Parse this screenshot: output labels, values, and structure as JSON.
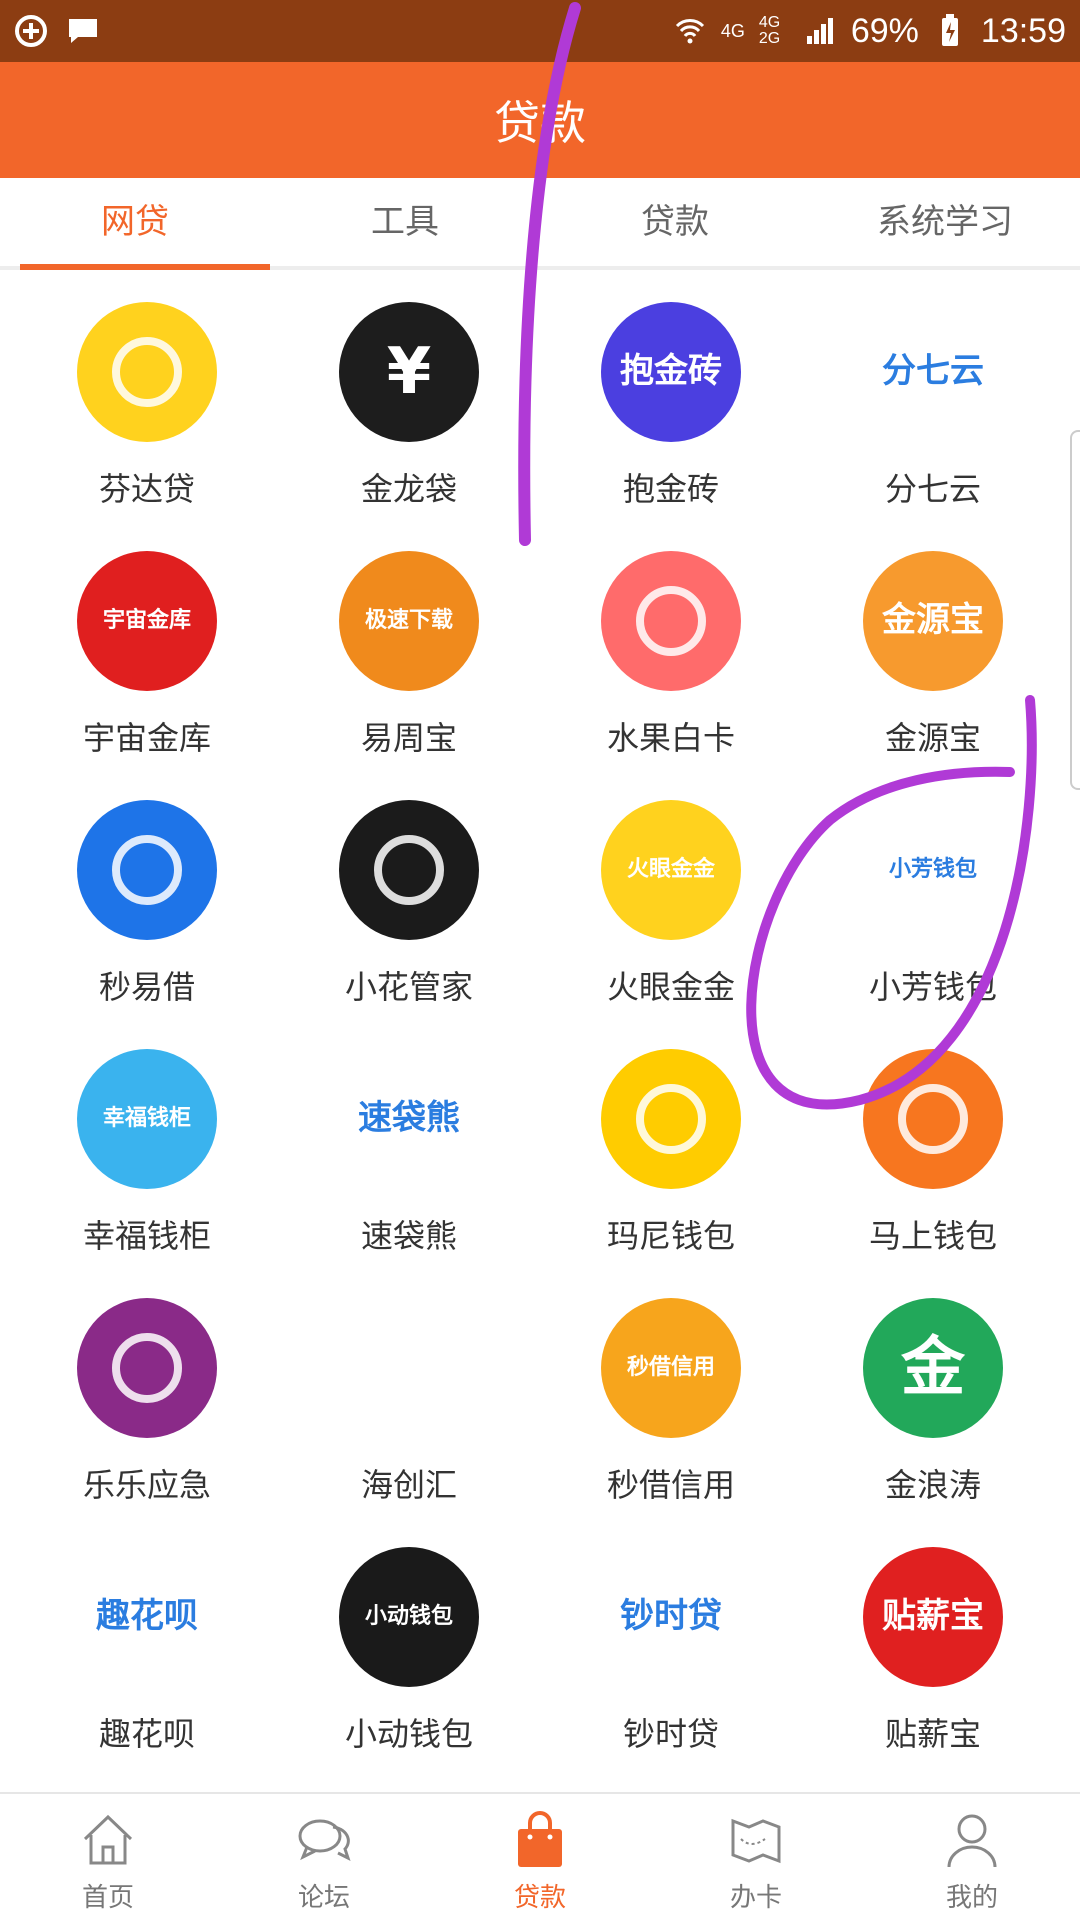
{
  "status_bar": {
    "net1": "4G",
    "net2": "4G 2G",
    "battery": "69%",
    "time": "13:59"
  },
  "header": {
    "title": "贷款"
  },
  "tabs": [
    {
      "label": "网贷",
      "active": true
    },
    {
      "label": "工具",
      "active": false
    },
    {
      "label": "贷款",
      "active": false
    },
    {
      "label": "系统学习",
      "active": false
    }
  ],
  "apps": [
    {
      "name": "芬达贷",
      "icon": "orange-fruit-icon",
      "bg": "#ffd21e"
    },
    {
      "name": "金龙袋",
      "icon": "yen-pouch-icon",
      "bg": "#1d1d1d",
      "glyph": "¥"
    },
    {
      "name": "抱金砖",
      "icon": "gold-brick-icon",
      "bg": "#4b3fe0",
      "glyph": "抱金砖"
    },
    {
      "name": "分七云",
      "icon": "cloud-icon",
      "bg": "#ffffff",
      "glyph": "分七云"
    },
    {
      "name": "宇宙金库",
      "icon": "planet-icon",
      "bg": "#e01f1f",
      "glyph": "宇宙金库"
    },
    {
      "name": "易周宝",
      "icon": "bull-icon",
      "bg": "#f08a1c",
      "glyph": "极速下载"
    },
    {
      "name": "水果白卡",
      "icon": "fruit-card-icon",
      "bg": "#ff6b6b"
    },
    {
      "name": "金源宝",
      "icon": "gold-ingot-icon",
      "bg": "#f79a2e",
      "glyph": "金源宝"
    },
    {
      "name": "秒易借",
      "icon": "lock-circle-icon",
      "bg": "#1e74e8"
    },
    {
      "name": "小花管家",
      "icon": "lotus-icon",
      "bg": "#1b1b1b"
    },
    {
      "name": "火眼金金",
      "icon": "monkey-icon",
      "bg": "#ffd21e",
      "glyph": "火眼金金"
    },
    {
      "name": "小芳钱包",
      "icon": "red-wallet-icon",
      "bg": "#ffffff",
      "glyph": "小芳钱包"
    },
    {
      "name": "幸福钱柜",
      "icon": "happy-cabinet-icon",
      "bg": "#3ab3ee",
      "glyph": "幸福钱柜"
    },
    {
      "name": "速袋熊",
      "icon": "bear-icon",
      "bg": "#ffffff",
      "glyph": "速袋熊"
    },
    {
      "name": "玛尼钱包",
      "icon": "money-wallet-icon",
      "bg": "#ffcc00"
    },
    {
      "name": "马上钱包",
      "icon": "running-horse-icon",
      "bg": "#f7761f"
    },
    {
      "name": "乐乐应急",
      "icon": "emergency-ring-icon",
      "bg": "#8a2a88"
    },
    {
      "name": "海创汇",
      "icon": "moon-swirl-icon",
      "bg": "#ffffff"
    },
    {
      "name": "秒借信用",
      "icon": "credit-icon",
      "bg": "#f7a51c",
      "glyph": "秒借信用"
    },
    {
      "name": "金浪涛",
      "icon": "gold-wave-icon",
      "bg": "#22a85a",
      "glyph": "金"
    },
    {
      "name": "趣花呗",
      "icon": "wave-drop-icon",
      "bg": "#ffffff",
      "glyph": "趣花呗"
    },
    {
      "name": "小动钱包",
      "icon": "green-wallet-icon",
      "bg": "#1a1a1a",
      "glyph": "小动钱包"
    },
    {
      "name": "钞时贷",
      "icon": "cash-ticket-icon",
      "bg": "#ffffff",
      "glyph": "钞时贷"
    },
    {
      "name": "贴薪宝",
      "icon": "chick-icon",
      "bg": "#e02020",
      "glyph": "贴薪宝"
    }
  ],
  "nav": [
    {
      "label": "首页",
      "icon": "home-icon",
      "active": false
    },
    {
      "label": "论坛",
      "icon": "chat-bubbles-icon",
      "active": false
    },
    {
      "label": "贷款",
      "icon": "shopping-bag-icon",
      "active": true
    },
    {
      "label": "办卡",
      "icon": "map-card-icon",
      "active": false
    },
    {
      "label": "我的",
      "icon": "person-icon",
      "active": false
    }
  ],
  "colors": {
    "accent": "#f2662a",
    "status_bar": "#8c3d12",
    "annotation": "#b03ad6"
  }
}
